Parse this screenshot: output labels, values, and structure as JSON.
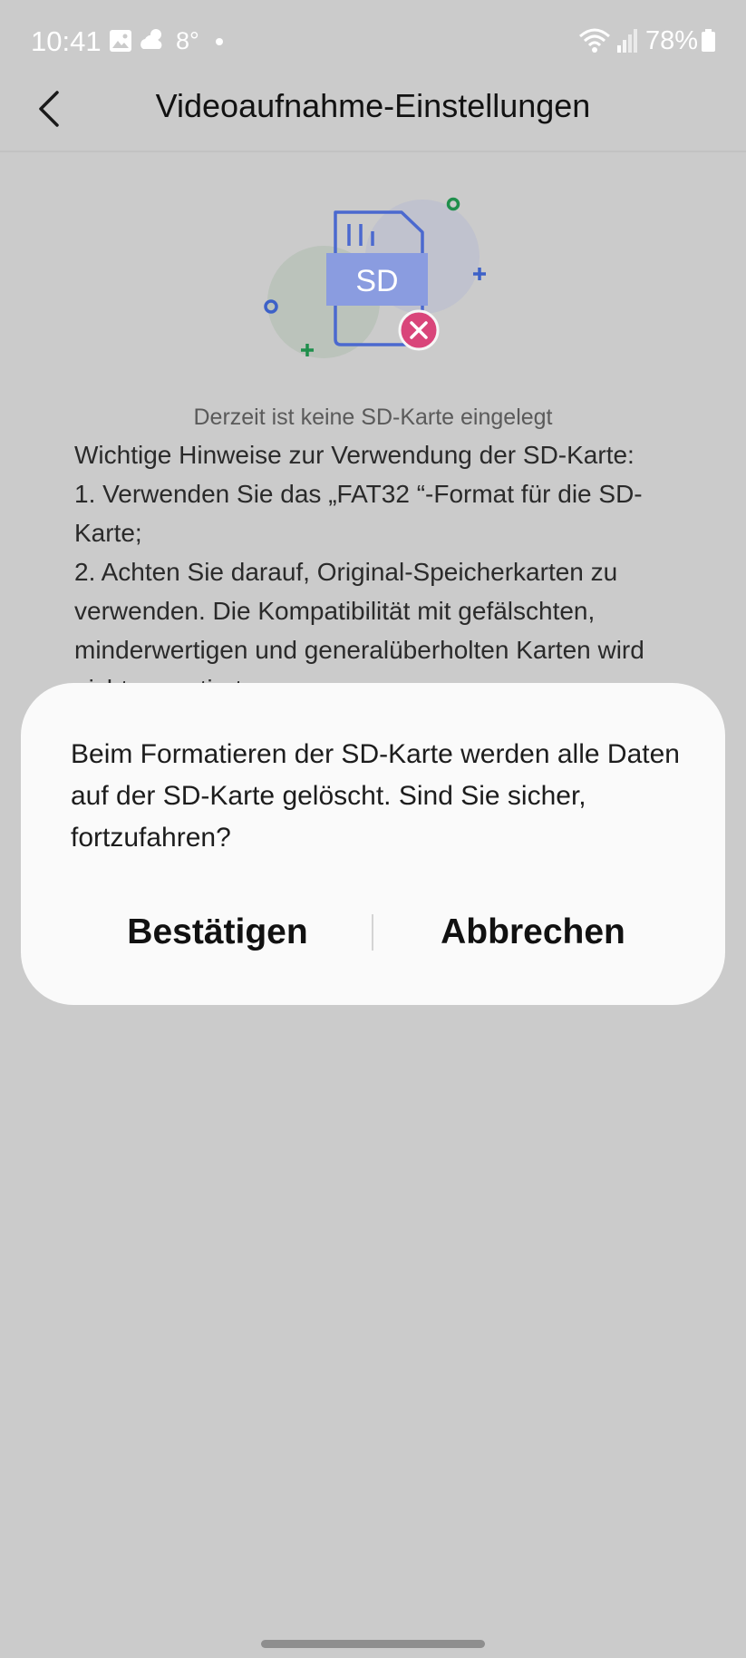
{
  "status_bar": {
    "time": "10:41",
    "temperature": "8°",
    "battery": "78%",
    "icons": [
      "gallery-icon",
      "weather-cloud-icon",
      "wifi-icon",
      "signal-icon",
      "battery-icon"
    ]
  },
  "header": {
    "title": "Videoaufnahme-Einstellungen",
    "back_icon": "chevron-left-icon"
  },
  "illustration": {
    "label": "SD",
    "icon": "sd-card-error-icon"
  },
  "main": {
    "no_sd_message": "Derzeit ist keine SD-Karte eingelegt",
    "notes": [
      "Wichtige Hinweise zur Verwendung der SD-Karte:",
      "1. Verwenden Sie das „FAT32  “-Format für die SD-Karte;",
      "2. Achten Sie darauf, Original-Speicherkarten zu verwenden. Die Kompatibilität mit gefälschten, minderwertigen und generalüberholten Karten wird nicht garantiert."
    ]
  },
  "dialog": {
    "message": "Beim Formatieren der SD-Karte werden alle Daten auf der SD-Karte gelöscht. Sind Sie sicher, fortzufahren?",
    "confirm_label": "Bestätigen",
    "cancel_label": "Abbrechen"
  },
  "colors": {
    "overlay": "#cbcbcb",
    "dialog_bg": "#fafafa",
    "sd_blue": "#8a9ce0",
    "error_pink": "#d9457a",
    "accent_green": "#1f8f4c"
  }
}
